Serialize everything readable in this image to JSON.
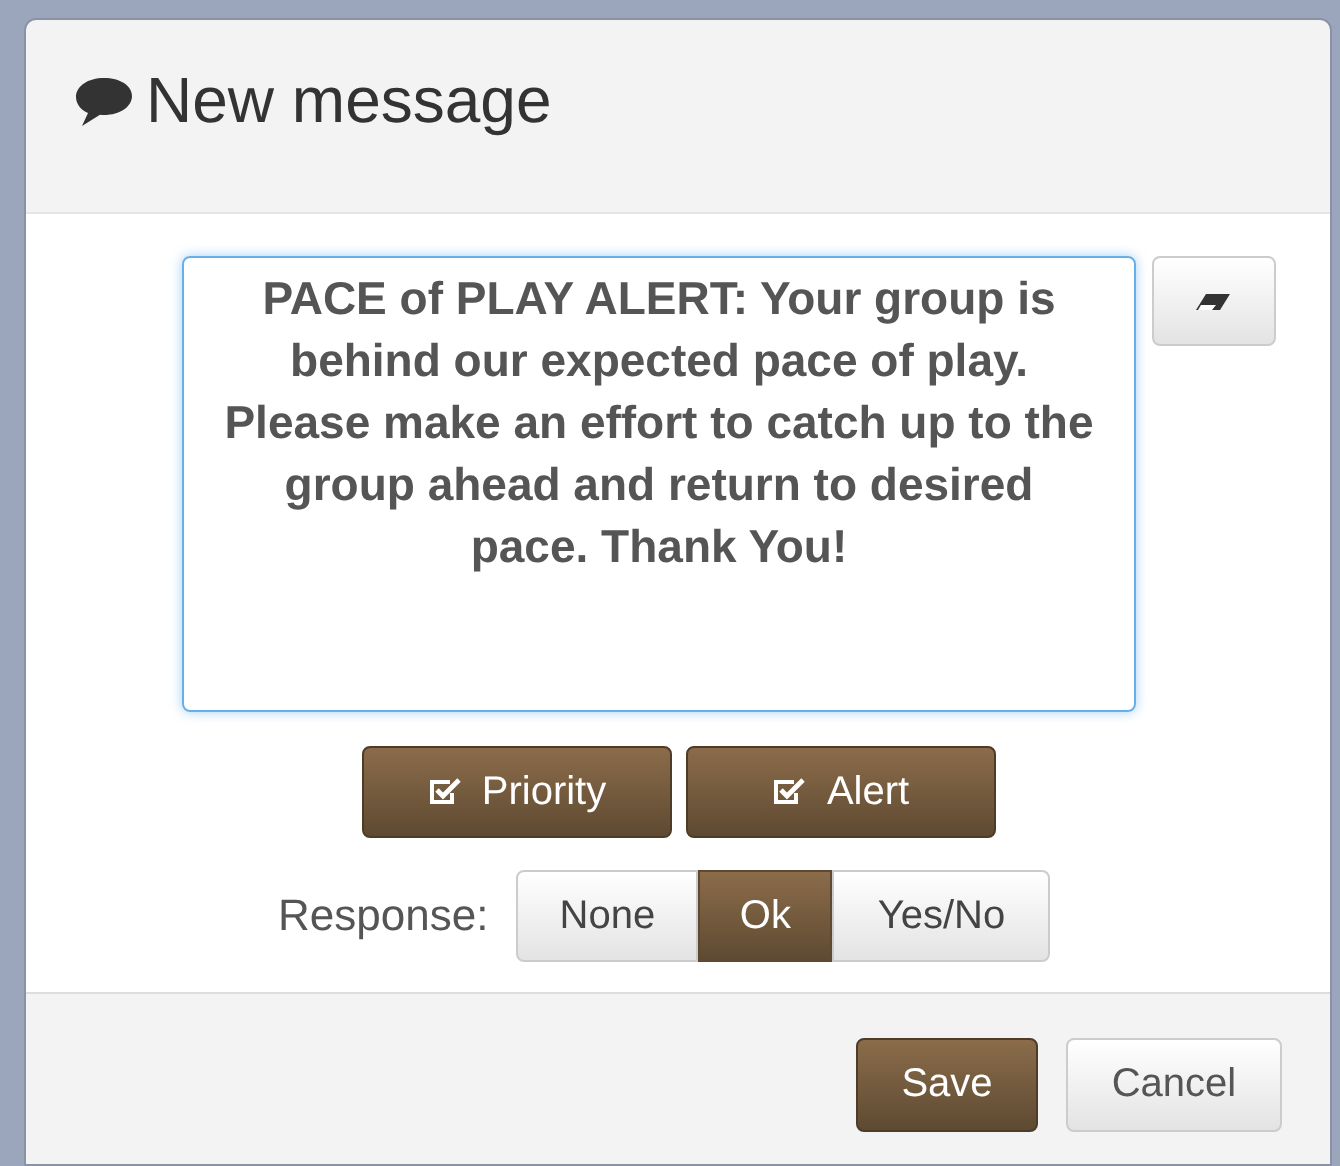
{
  "dialog": {
    "title": "New message"
  },
  "message": {
    "value": "PACE of PLAY ALERT: Your group is behind our expected pace of play.  Please make an effort to catch up to the group ahead and return to desired pace. Thank You!"
  },
  "toggles": [
    {
      "label": "Priority",
      "checked": true
    },
    {
      "label": "Alert",
      "checked": true
    }
  ],
  "response": {
    "label": "Response:",
    "options": [
      {
        "label": "None",
        "selected": false
      },
      {
        "label": "Ok",
        "selected": true
      },
      {
        "label": "Yes/No",
        "selected": false
      }
    ]
  },
  "footer_buttons": [
    {
      "label": "Save",
      "kind": "primary"
    },
    {
      "label": "Cancel",
      "kind": "default"
    }
  ]
}
